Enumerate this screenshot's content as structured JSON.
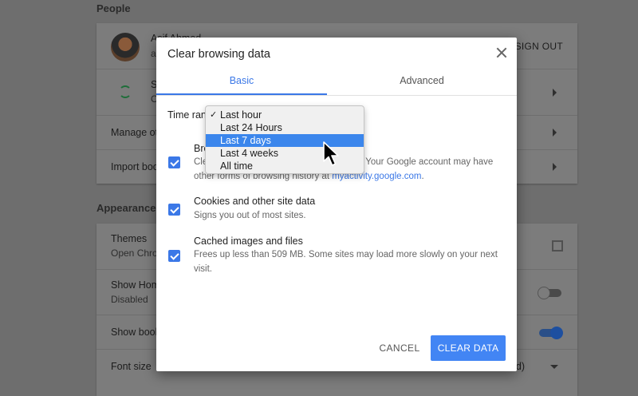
{
  "background": {
    "sections": {
      "people": "People",
      "appearance": "Appearance"
    },
    "people": {
      "user_name": "Asif Ahmed",
      "user_sub": "a",
      "sign_out": "SIGN OUT",
      "sync_label": "S",
      "sync_sub": "O",
      "manage_other": "Manage oth",
      "import": "Import boo"
    },
    "appearance": {
      "themes_label": "Themes",
      "themes_sub": "Open Chron",
      "show_home_label": "Show Hom",
      "show_home_sub": "Disabled",
      "show_bookmarks_label": "Show book",
      "font_size_label": "Font size",
      "font_size_value": "d)"
    }
  },
  "dialog": {
    "title": "Clear browsing data",
    "tabs": [
      {
        "label": "Basic",
        "active": true
      },
      {
        "label": "Advanced",
        "active": false
      }
    ],
    "time_range_label": "Time rang",
    "options": [
      {
        "title": "Bro",
        "desc_prefix": "Cle",
        "desc_mid": "Your Google account may have",
        "desc_line2_prefix": "other forms of browsing history at ",
        "desc_link": "myactivity.google.com",
        "desc_suffix": ".",
        "checked": true
      },
      {
        "title": "Cookies and other site data",
        "desc": "Signs you out of most sites.",
        "checked": true
      },
      {
        "title": "Cached images and files",
        "desc": "Frees up less than 509 MB. Some sites may load more slowly on your next visit.",
        "checked": true
      }
    ],
    "cancel_label": "CANCEL",
    "clear_label": "CLEAR DATA"
  },
  "dropdown": {
    "items": [
      "Last hour",
      "Last 24 Hours",
      "Last 7 days",
      "Last 4 weeks",
      "All time"
    ],
    "selected": "Last hour",
    "highlighted": "Last 7 days",
    "check_glyph": "✓"
  },
  "colors": {
    "accent": "#3b78e7",
    "button": "#4285f4",
    "menu_highlight": "#3b86ec"
  },
  "icons": [
    "close-icon",
    "checkbox-checked-icon",
    "sync-icon",
    "external-link-icon",
    "chevron-right-icon",
    "caret-down-icon",
    "mouse-pointer-icon"
  ]
}
